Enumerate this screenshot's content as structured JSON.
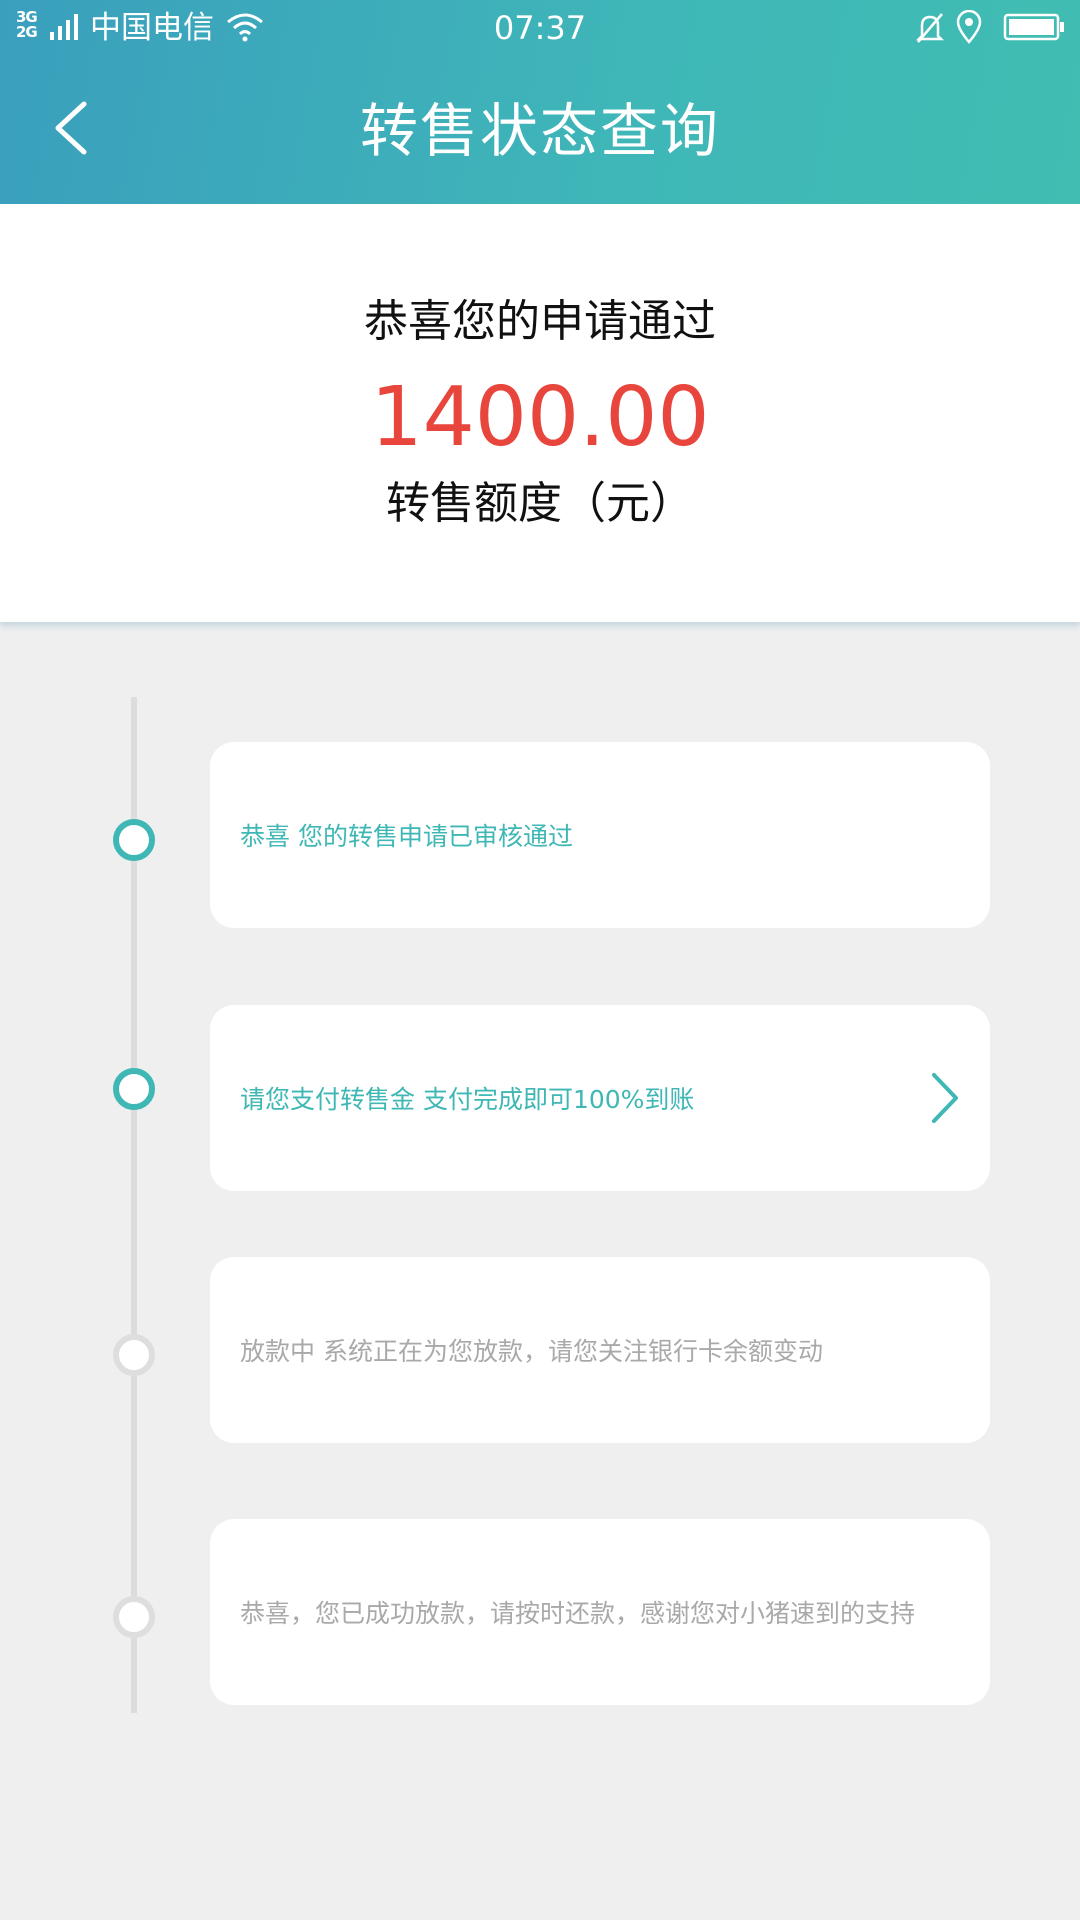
{
  "status_bar": {
    "network": "3G 2G",
    "carrier": "中国电信",
    "time": "07:37"
  },
  "header": {
    "title": "转售状态查询"
  },
  "summary": {
    "congrats": "恭喜您的申请通过",
    "amount": "1400.00",
    "amount_label": "转售额度（元）"
  },
  "steps": [
    {
      "text": "恭喜 您的转售申请已审核通过",
      "status": "done"
    },
    {
      "text": "请您支付转售金 支付完成即可100%到账",
      "status": "current"
    },
    {
      "text": "放款中 系统正在为您放款，请您关注银行卡余额变动",
      "status": "pending"
    },
    {
      "text": "恭喜，您已成功放款，请按时还款，感谢您对小猪速到的支持",
      "status": "pending"
    }
  ],
  "colors": {
    "accent": "#3fb7b4",
    "amount": "#e8453c",
    "inactive": "#a9a9a9"
  },
  "icons": [
    "back-arrow-icon",
    "wifi-icon",
    "bell-muted-icon",
    "location-icon",
    "battery-icon",
    "chevron-right-icon"
  ]
}
